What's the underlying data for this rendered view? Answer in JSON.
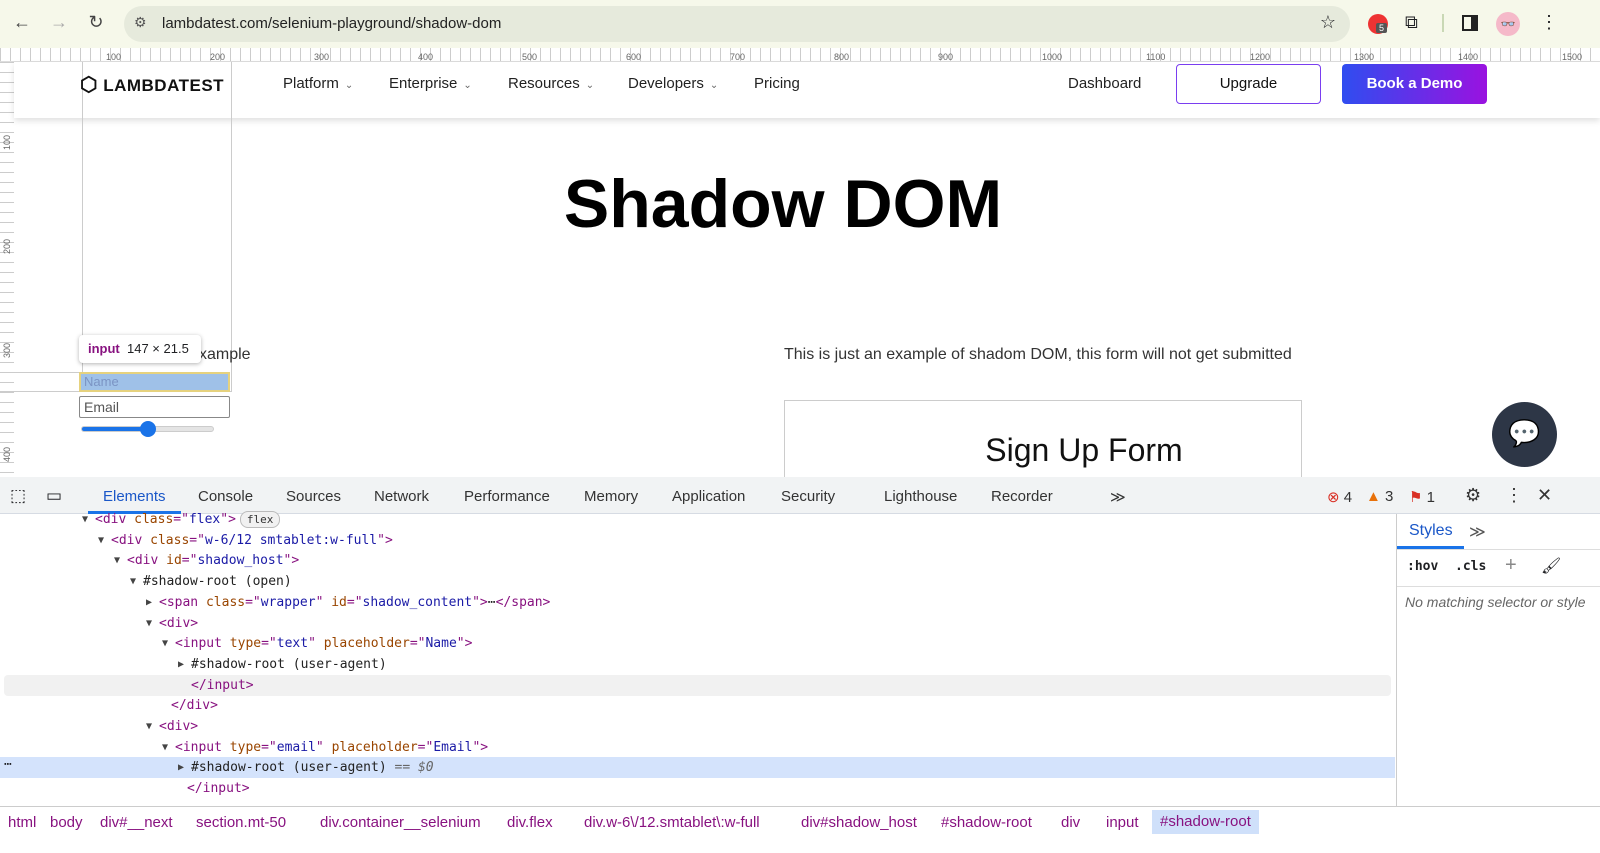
{
  "browser": {
    "url": "lambdatest.com/selenium-playground/shadow-dom",
    "extension_badge": "5"
  },
  "ruler": {
    "top": [
      "100",
      "200",
      "300",
      "400",
      "500",
      "600",
      "700",
      "800",
      "900",
      "1000",
      "1100",
      "1200",
      "1300",
      "1400",
      "1500"
    ],
    "left": [
      "100",
      "200",
      "300",
      "400"
    ]
  },
  "site": {
    "logo": "LAMBDATEST",
    "nav": [
      "Platform",
      "Enterprise",
      "Resources",
      "Developers",
      "Pricing"
    ],
    "dashboard": "Dashboard",
    "upgrade": "Upgrade",
    "demo": "Book a Demo",
    "title": "Shadow DOM",
    "example_partial": "xample",
    "description": "This is just an example of shadom DOM, this form will not get submitted",
    "form_title": "Sign Up Form",
    "name_placeholder": "Name",
    "email_placeholder": "Email",
    "slider_value": 0.5,
    "accent": "#7a3ef0"
  },
  "tooltip": {
    "tag": "input",
    "size": "147 × 21.5"
  },
  "devtools": {
    "tabs": [
      "Elements",
      "Console",
      "Sources",
      "Network",
      "Performance",
      "Memory",
      "Application",
      "Security",
      "Lighthouse",
      "Recorder"
    ],
    "active_tab": "Elements",
    "errors": "4",
    "warnings": "3",
    "issues": "1",
    "styles_tab": "Styles",
    "hov": ":hov",
    "cls": ".cls",
    "no_match": "No matching selector or style",
    "lines": [
      {
        "arrow": "▼",
        "parts": [
          [
            "tg",
            "<div "
          ],
          [
            "an",
            "class"
          ],
          [
            "tg",
            "=\""
          ],
          [
            "av",
            "flex"
          ],
          [
            "tg",
            "\">"
          ]
        ],
        "badge": "flex"
      },
      {
        "arrow": "▼",
        "parts": [
          [
            "tg",
            "<div "
          ],
          [
            "an",
            "class"
          ],
          [
            "tg",
            "=\""
          ],
          [
            "av",
            "w-6/12 smtablet:w-full"
          ],
          [
            "tg",
            "\">"
          ]
        ]
      },
      {
        "arrow": "▼",
        "parts": [
          [
            "tg",
            "<div "
          ],
          [
            "an",
            "id"
          ],
          [
            "tg",
            "=\""
          ],
          [
            "av",
            "shadow_host"
          ],
          [
            "tg",
            "\">"
          ]
        ]
      },
      {
        "arrow": "▼",
        "parts": [
          [
            "tx",
            "#shadow-root (open)"
          ]
        ]
      },
      {
        "arrow": "▶",
        "parts": [
          [
            "tg",
            "<span "
          ],
          [
            "an",
            "class"
          ],
          [
            "tg",
            "=\""
          ],
          [
            "av",
            "wrapper"
          ],
          [
            "tg",
            "\" "
          ],
          [
            "an",
            "id"
          ],
          [
            "tg",
            "=\""
          ],
          [
            "av",
            "shadow_content"
          ],
          [
            "tg",
            "\">"
          ],
          [
            "tx",
            "⋯"
          ],
          [
            "tg",
            "</span>"
          ]
        ]
      },
      {
        "arrow": "▼",
        "parts": [
          [
            "tg",
            "<div>"
          ]
        ]
      },
      {
        "arrow": "▼",
        "parts": [
          [
            "tg",
            "<input "
          ],
          [
            "an",
            "type"
          ],
          [
            "tg",
            "=\""
          ],
          [
            "av",
            "text"
          ],
          [
            "tg",
            "\" "
          ],
          [
            "an",
            "placeholder"
          ],
          [
            "tg",
            "=\""
          ],
          [
            "av",
            "Name"
          ],
          [
            "tg",
            "\">"
          ]
        ]
      },
      {
        "arrow": "▶",
        "parts": [
          [
            "tx",
            "#shadow-root (user-agent)"
          ]
        ]
      },
      {
        "arrow": "",
        "parts": [
          [
            "tg",
            "</input>"
          ]
        ]
      },
      {
        "arrow": "",
        "parts": [
          [
            "tg",
            "</div>"
          ]
        ]
      },
      {
        "arrow": "▼",
        "parts": [
          [
            "tg",
            "<div>"
          ]
        ]
      },
      {
        "arrow": "▼",
        "parts": [
          [
            "tg",
            "<input "
          ],
          [
            "an",
            "type"
          ],
          [
            "tg",
            "=\""
          ],
          [
            "av",
            "email"
          ],
          [
            "tg",
            "\" "
          ],
          [
            "an",
            "placeholder"
          ],
          [
            "tg",
            "=\""
          ],
          [
            "av",
            "Email"
          ],
          [
            "tg",
            "\">"
          ]
        ]
      },
      {
        "arrow": "▶",
        "parts": [
          [
            "tx",
            "#shadow-root (user-agent)"
          ],
          [
            "dm",
            " == $0"
          ]
        ]
      },
      {
        "arrow": "",
        "parts": [
          [
            "tg",
            "</input>"
          ]
        ]
      }
    ],
    "breadcrumbs": [
      "html",
      "body",
      "div#__next",
      "section.mt-50",
      "div.container__selenium",
      "div.flex",
      "div.w-6\\/12.smtablet\\:w-full",
      "div#shadow_host",
      "#shadow-root",
      "div",
      "input",
      "#shadow-root"
    ]
  }
}
